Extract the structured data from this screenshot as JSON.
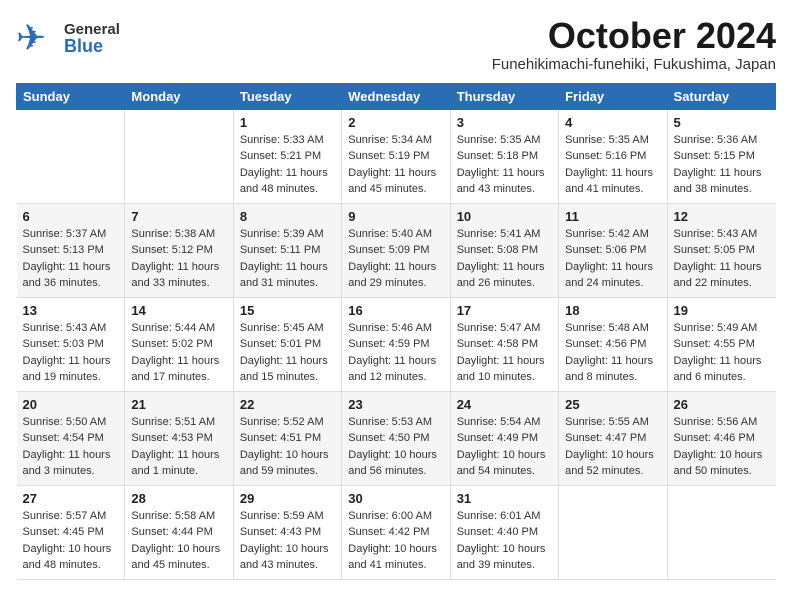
{
  "header": {
    "logo_general": "General",
    "logo_blue": "Blue",
    "title": "October 2024",
    "subtitle": "Funehikimachi-funehiki, Fukushima, Japan"
  },
  "days_of_week": [
    "Sunday",
    "Monday",
    "Tuesday",
    "Wednesday",
    "Thursday",
    "Friday",
    "Saturday"
  ],
  "weeks": [
    [
      {
        "num": "",
        "sunrise": "",
        "sunset": "",
        "daylight": ""
      },
      {
        "num": "",
        "sunrise": "",
        "sunset": "",
        "daylight": ""
      },
      {
        "num": "1",
        "sunrise": "Sunrise: 5:33 AM",
        "sunset": "Sunset: 5:21 PM",
        "daylight": "Daylight: 11 hours and 48 minutes."
      },
      {
        "num": "2",
        "sunrise": "Sunrise: 5:34 AM",
        "sunset": "Sunset: 5:19 PM",
        "daylight": "Daylight: 11 hours and 45 minutes."
      },
      {
        "num": "3",
        "sunrise": "Sunrise: 5:35 AM",
        "sunset": "Sunset: 5:18 PM",
        "daylight": "Daylight: 11 hours and 43 minutes."
      },
      {
        "num": "4",
        "sunrise": "Sunrise: 5:35 AM",
        "sunset": "Sunset: 5:16 PM",
        "daylight": "Daylight: 11 hours and 41 minutes."
      },
      {
        "num": "5",
        "sunrise": "Sunrise: 5:36 AM",
        "sunset": "Sunset: 5:15 PM",
        "daylight": "Daylight: 11 hours and 38 minutes."
      }
    ],
    [
      {
        "num": "6",
        "sunrise": "Sunrise: 5:37 AM",
        "sunset": "Sunset: 5:13 PM",
        "daylight": "Daylight: 11 hours and 36 minutes."
      },
      {
        "num": "7",
        "sunrise": "Sunrise: 5:38 AM",
        "sunset": "Sunset: 5:12 PM",
        "daylight": "Daylight: 11 hours and 33 minutes."
      },
      {
        "num": "8",
        "sunrise": "Sunrise: 5:39 AM",
        "sunset": "Sunset: 5:11 PM",
        "daylight": "Daylight: 11 hours and 31 minutes."
      },
      {
        "num": "9",
        "sunrise": "Sunrise: 5:40 AM",
        "sunset": "Sunset: 5:09 PM",
        "daylight": "Daylight: 11 hours and 29 minutes."
      },
      {
        "num": "10",
        "sunrise": "Sunrise: 5:41 AM",
        "sunset": "Sunset: 5:08 PM",
        "daylight": "Daylight: 11 hours and 26 minutes."
      },
      {
        "num": "11",
        "sunrise": "Sunrise: 5:42 AM",
        "sunset": "Sunset: 5:06 PM",
        "daylight": "Daylight: 11 hours and 24 minutes."
      },
      {
        "num": "12",
        "sunrise": "Sunrise: 5:43 AM",
        "sunset": "Sunset: 5:05 PM",
        "daylight": "Daylight: 11 hours and 22 minutes."
      }
    ],
    [
      {
        "num": "13",
        "sunrise": "Sunrise: 5:43 AM",
        "sunset": "Sunset: 5:03 PM",
        "daylight": "Daylight: 11 hours and 19 minutes."
      },
      {
        "num": "14",
        "sunrise": "Sunrise: 5:44 AM",
        "sunset": "Sunset: 5:02 PM",
        "daylight": "Daylight: 11 hours and 17 minutes."
      },
      {
        "num": "15",
        "sunrise": "Sunrise: 5:45 AM",
        "sunset": "Sunset: 5:01 PM",
        "daylight": "Daylight: 11 hours and 15 minutes."
      },
      {
        "num": "16",
        "sunrise": "Sunrise: 5:46 AM",
        "sunset": "Sunset: 4:59 PM",
        "daylight": "Daylight: 11 hours and 12 minutes."
      },
      {
        "num": "17",
        "sunrise": "Sunrise: 5:47 AM",
        "sunset": "Sunset: 4:58 PM",
        "daylight": "Daylight: 11 hours and 10 minutes."
      },
      {
        "num": "18",
        "sunrise": "Sunrise: 5:48 AM",
        "sunset": "Sunset: 4:56 PM",
        "daylight": "Daylight: 11 hours and 8 minutes."
      },
      {
        "num": "19",
        "sunrise": "Sunrise: 5:49 AM",
        "sunset": "Sunset: 4:55 PM",
        "daylight": "Daylight: 11 hours and 6 minutes."
      }
    ],
    [
      {
        "num": "20",
        "sunrise": "Sunrise: 5:50 AM",
        "sunset": "Sunset: 4:54 PM",
        "daylight": "Daylight: 11 hours and 3 minutes."
      },
      {
        "num": "21",
        "sunrise": "Sunrise: 5:51 AM",
        "sunset": "Sunset: 4:53 PM",
        "daylight": "Daylight: 11 hours and 1 minute."
      },
      {
        "num": "22",
        "sunrise": "Sunrise: 5:52 AM",
        "sunset": "Sunset: 4:51 PM",
        "daylight": "Daylight: 10 hours and 59 minutes."
      },
      {
        "num": "23",
        "sunrise": "Sunrise: 5:53 AM",
        "sunset": "Sunset: 4:50 PM",
        "daylight": "Daylight: 10 hours and 56 minutes."
      },
      {
        "num": "24",
        "sunrise": "Sunrise: 5:54 AM",
        "sunset": "Sunset: 4:49 PM",
        "daylight": "Daylight: 10 hours and 54 minutes."
      },
      {
        "num": "25",
        "sunrise": "Sunrise: 5:55 AM",
        "sunset": "Sunset: 4:47 PM",
        "daylight": "Daylight: 10 hours and 52 minutes."
      },
      {
        "num": "26",
        "sunrise": "Sunrise: 5:56 AM",
        "sunset": "Sunset: 4:46 PM",
        "daylight": "Daylight: 10 hours and 50 minutes."
      }
    ],
    [
      {
        "num": "27",
        "sunrise": "Sunrise: 5:57 AM",
        "sunset": "Sunset: 4:45 PM",
        "daylight": "Daylight: 10 hours and 48 minutes."
      },
      {
        "num": "28",
        "sunrise": "Sunrise: 5:58 AM",
        "sunset": "Sunset: 4:44 PM",
        "daylight": "Daylight: 10 hours and 45 minutes."
      },
      {
        "num": "29",
        "sunrise": "Sunrise: 5:59 AM",
        "sunset": "Sunset: 4:43 PM",
        "daylight": "Daylight: 10 hours and 43 minutes."
      },
      {
        "num": "30",
        "sunrise": "Sunrise: 6:00 AM",
        "sunset": "Sunset: 4:42 PM",
        "daylight": "Daylight: 10 hours and 41 minutes."
      },
      {
        "num": "31",
        "sunrise": "Sunrise: 6:01 AM",
        "sunset": "Sunset: 4:40 PM",
        "daylight": "Daylight: 10 hours and 39 minutes."
      },
      {
        "num": "",
        "sunrise": "",
        "sunset": "",
        "daylight": ""
      },
      {
        "num": "",
        "sunrise": "",
        "sunset": "",
        "daylight": ""
      }
    ]
  ]
}
